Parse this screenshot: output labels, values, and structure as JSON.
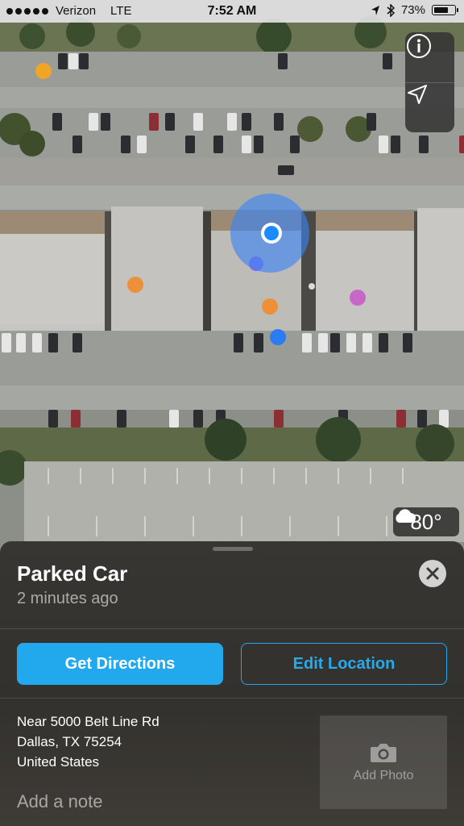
{
  "status_bar": {
    "carrier": "Verizon",
    "network": "LTE",
    "time": "7:52 AM",
    "battery_percent": "73%",
    "battery_level": 0.73
  },
  "map": {
    "info_icon": "info-icon",
    "location_icon": "location-arrow-icon",
    "weather": {
      "icon": "cloud-icon",
      "temperature": "80°"
    },
    "colors": {
      "user_location": "#1a8cff",
      "accuracy_circle": "#3a84f6"
    }
  },
  "card": {
    "title": "Parked Car",
    "subtitle": "2 minutes ago",
    "buttons": {
      "directions": "Get Directions",
      "edit_location": "Edit Location"
    },
    "address": {
      "line1": "Near 5000 Belt Line Rd",
      "line2": "Dallas, TX  75254",
      "line3": "United States"
    },
    "add_note": "Add a note",
    "add_photo": "Add Photo",
    "accent_color": "#22a8ec"
  }
}
